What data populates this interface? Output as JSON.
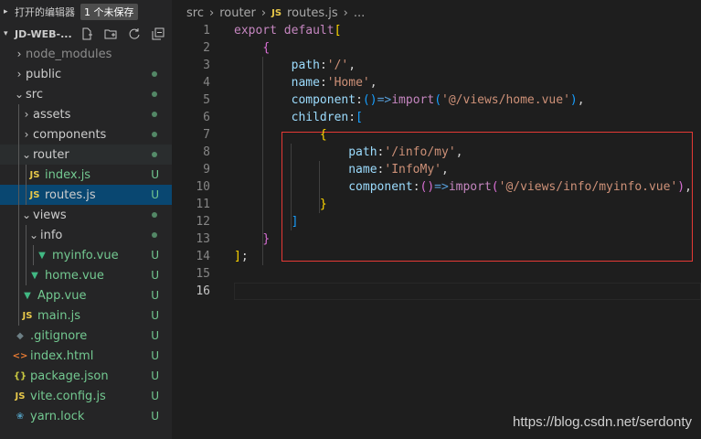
{
  "sidebar": {
    "open_editors_label": "打开的编辑器",
    "unsaved_badge": "1 个未保存",
    "project_name": "JD-WEB-...",
    "actions": [
      "new-file-icon",
      "new-folder-icon",
      "refresh-icon",
      "collapse-icon"
    ],
    "items": [
      {
        "label": "node_modules",
        "type": "folder",
        "expanded": false,
        "depth": 0,
        "status": "",
        "dot": false,
        "style": "dim"
      },
      {
        "label": "public",
        "type": "folder",
        "expanded": false,
        "depth": 0,
        "status": "",
        "dot": true,
        "style": "normal"
      },
      {
        "label": "src",
        "type": "folder",
        "expanded": true,
        "depth": 0,
        "status": "",
        "dot": true,
        "style": "normal"
      },
      {
        "label": "assets",
        "type": "folder",
        "expanded": false,
        "depth": 1,
        "status": "",
        "dot": true,
        "style": "normal"
      },
      {
        "label": "components",
        "type": "folder",
        "expanded": false,
        "depth": 1,
        "status": "",
        "dot": true,
        "style": "normal"
      },
      {
        "label": "router",
        "type": "folder",
        "expanded": true,
        "depth": 1,
        "status": "",
        "dot": true,
        "style": "normal"
      },
      {
        "label": "index.js",
        "type": "js",
        "depth": 2,
        "status": "U",
        "dot": false,
        "style": "green"
      },
      {
        "label": "routes.js",
        "type": "js",
        "depth": 2,
        "status": "U",
        "dot": false,
        "style": "normal",
        "selected": true
      },
      {
        "label": "views",
        "type": "folder",
        "expanded": true,
        "depth": 1,
        "status": "",
        "dot": true,
        "style": "normal"
      },
      {
        "label": "info",
        "type": "folder",
        "expanded": true,
        "depth": 2,
        "status": "",
        "dot": true,
        "style": "normal"
      },
      {
        "label": "myinfo.vue",
        "type": "vue",
        "depth": 3,
        "status": "U",
        "dot": false,
        "style": "green"
      },
      {
        "label": "home.vue",
        "type": "vue",
        "depth": 2,
        "status": "U",
        "dot": false,
        "style": "green"
      },
      {
        "label": "App.vue",
        "type": "vue",
        "depth": 1,
        "status": "U",
        "dot": false,
        "style": "green"
      },
      {
        "label": "main.js",
        "type": "js",
        "depth": 1,
        "status": "U",
        "dot": false,
        "style": "green"
      },
      {
        "label": ".gitignore",
        "type": "git",
        "depth": 0,
        "status": "U",
        "dot": false,
        "style": "green"
      },
      {
        "label": "index.html",
        "type": "html",
        "depth": 0,
        "status": "U",
        "dot": false,
        "style": "green"
      },
      {
        "label": "package.json",
        "type": "json",
        "depth": 0,
        "status": "U",
        "dot": false,
        "style": "green"
      },
      {
        "label": "vite.config.js",
        "type": "js",
        "depth": 0,
        "status": "U",
        "dot": false,
        "style": "green"
      },
      {
        "label": "yarn.lock",
        "type": "yarn",
        "depth": 0,
        "status": "U",
        "dot": false,
        "style": "green"
      }
    ]
  },
  "editor": {
    "breadcrumb": [
      "src",
      "router",
      "routes.js",
      "..."
    ],
    "active_line": 16,
    "lines": [
      [
        {
          "t": "export",
          "c": "kw2"
        },
        {
          "t": " "
        },
        {
          "t": "default",
          "c": "kw2"
        },
        {
          "t": "[",
          "c": "brk1"
        }
      ],
      [
        {
          "t": "    "
        },
        {
          "t": "{",
          "c": "brk2"
        }
      ],
      [
        {
          "t": "        "
        },
        {
          "t": "path",
          "c": "prop"
        },
        {
          "t": ":",
          "c": "punc"
        },
        {
          "t": "'/'",
          "c": "str"
        },
        {
          "t": ",",
          "c": "punc"
        }
      ],
      [
        {
          "t": "        "
        },
        {
          "t": "name",
          "c": "prop"
        },
        {
          "t": ":",
          "c": "punc"
        },
        {
          "t": "'Home'",
          "c": "str"
        },
        {
          "t": ",",
          "c": "punc"
        }
      ],
      [
        {
          "t": "        "
        },
        {
          "t": "component",
          "c": "prop"
        },
        {
          "t": ":",
          "c": "punc"
        },
        {
          "t": "()",
          "c": "brk3"
        },
        {
          "t": "=>",
          "c": "arrow-op"
        },
        {
          "t": "import",
          "c": "kw2"
        },
        {
          "t": "(",
          "c": "brk3"
        },
        {
          "t": "'@/views/home.vue'",
          "c": "str"
        },
        {
          "t": ")",
          "c": "brk3"
        },
        {
          "t": ",",
          "c": "punc"
        }
      ],
      [
        {
          "t": "        "
        },
        {
          "t": "children",
          "c": "prop"
        },
        {
          "t": ":",
          "c": "punc"
        },
        {
          "t": "[",
          "c": "brk3"
        }
      ],
      [
        {
          "t": "            "
        },
        {
          "t": "{",
          "c": "brk1"
        }
      ],
      [
        {
          "t": "                "
        },
        {
          "t": "path",
          "c": "prop"
        },
        {
          "t": ":",
          "c": "punc"
        },
        {
          "t": "'/info/my'",
          "c": "str"
        },
        {
          "t": ",",
          "c": "punc"
        }
      ],
      [
        {
          "t": "                "
        },
        {
          "t": "name",
          "c": "prop"
        },
        {
          "t": ":",
          "c": "punc"
        },
        {
          "t": "'InfoMy'",
          "c": "str"
        },
        {
          "t": ",",
          "c": "punc"
        }
      ],
      [
        {
          "t": "                "
        },
        {
          "t": "component",
          "c": "prop"
        },
        {
          "t": ":",
          "c": "punc"
        },
        {
          "t": "()",
          "c": "brk2"
        },
        {
          "t": "=>",
          "c": "arrow-op"
        },
        {
          "t": "import",
          "c": "kw2"
        },
        {
          "t": "(",
          "c": "brk2"
        },
        {
          "t": "'@/views/info/myinfo.vue'",
          "c": "str"
        },
        {
          "t": ")",
          "c": "brk2"
        },
        {
          "t": ",",
          "c": "punc"
        }
      ],
      [
        {
          "t": "            "
        },
        {
          "t": "}",
          "c": "brk1"
        }
      ],
      [
        {
          "t": "        "
        },
        {
          "t": "]",
          "c": "brk3"
        }
      ],
      [
        {
          "t": "    "
        },
        {
          "t": "}",
          "c": "brk2"
        }
      ],
      [
        {
          "t": "]",
          "c": "brk1"
        },
        {
          "t": ";",
          "c": "punc"
        }
      ],
      [],
      []
    ]
  },
  "watermark": "https://blog.csdn.net/serdonty"
}
